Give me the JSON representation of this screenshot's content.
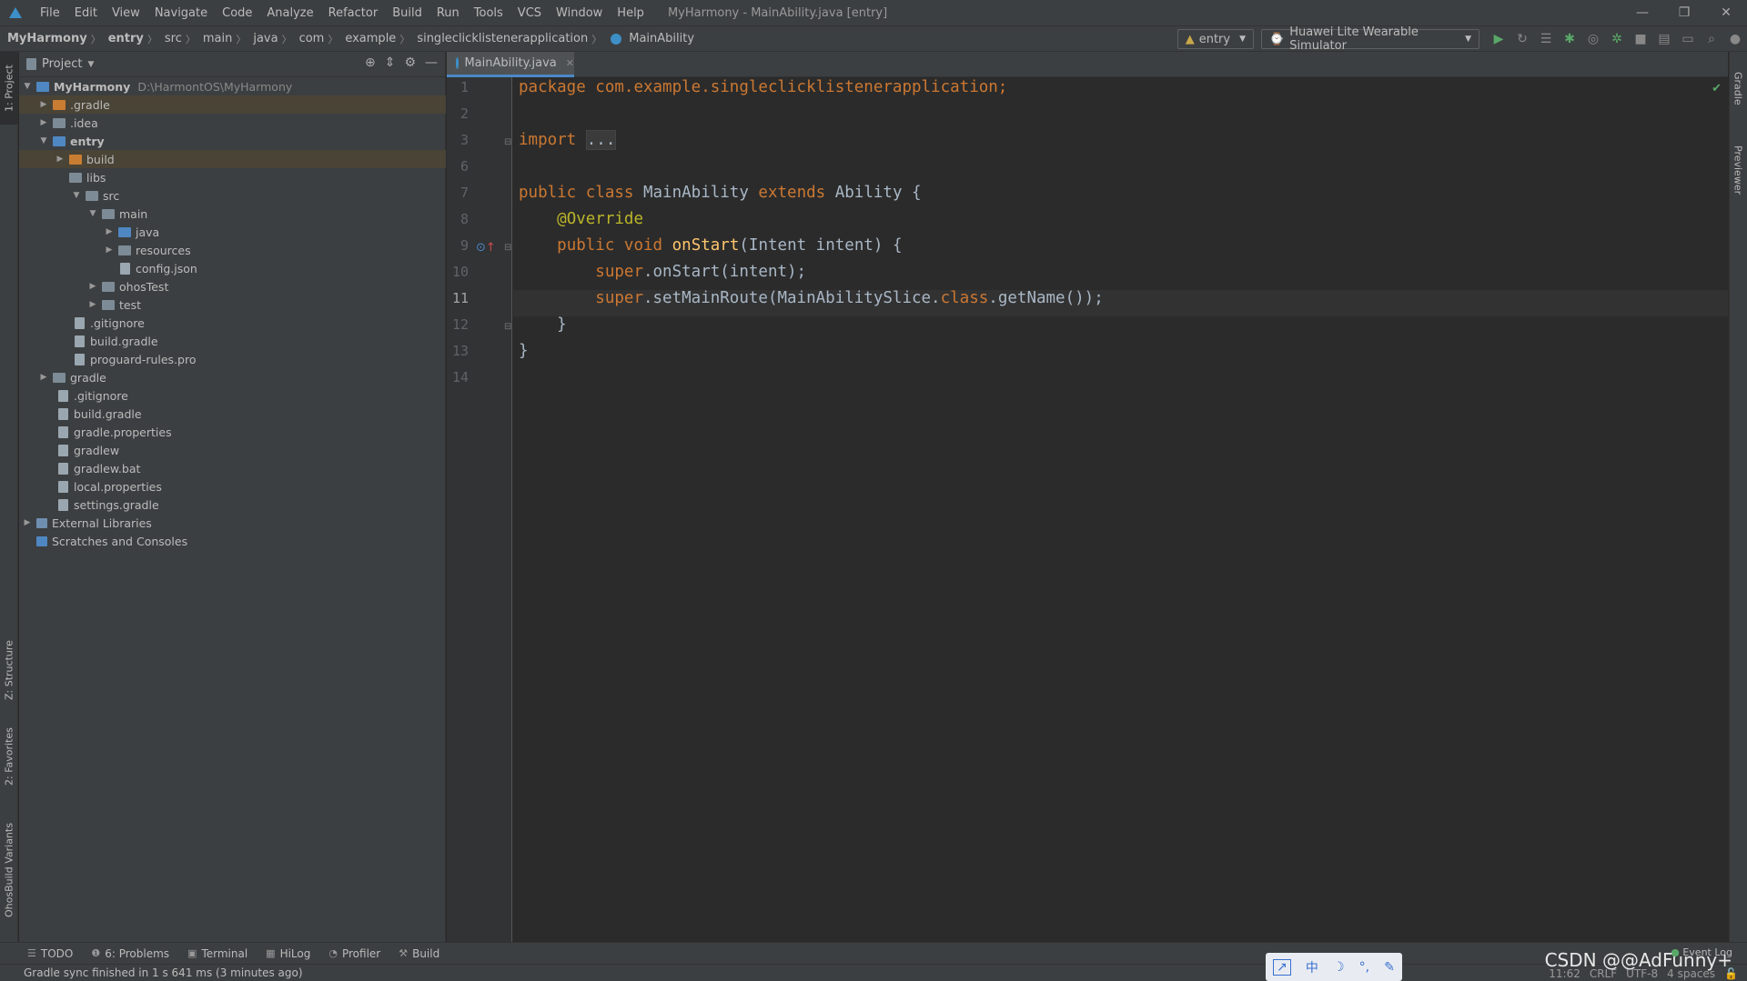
{
  "menu": {
    "items": [
      "File",
      "Edit",
      "View",
      "Navigate",
      "Code",
      "Analyze",
      "Refactor",
      "Build",
      "Run",
      "Tools",
      "VCS",
      "Window",
      "Help"
    ],
    "window_title": "MyHarmony - MainAbility.java [entry]"
  },
  "navbar": {
    "crumbs": [
      "MyHarmony",
      "entry",
      "src",
      "main",
      "java",
      "com",
      "example",
      "singleclicklistenerapplication",
      "MainAbility"
    ],
    "run_config": "entry",
    "device": "Huawei Lite Wearable Simulator"
  },
  "project": {
    "title": "Project",
    "tree": [
      {
        "label": "MyHarmony",
        "extra": "D:\\HarmontOS\\MyHarmony"
      },
      {
        "label": ".gradle"
      },
      {
        "label": ".idea"
      },
      {
        "label": "entry"
      },
      {
        "label": "build"
      },
      {
        "label": "libs"
      },
      {
        "label": "src"
      },
      {
        "label": "main"
      },
      {
        "label": "java"
      },
      {
        "label": "resources"
      },
      {
        "label": "config.json"
      },
      {
        "label": "ohosTest"
      },
      {
        "label": "test"
      },
      {
        "label": ".gitignore"
      },
      {
        "label": "build.gradle"
      },
      {
        "label": "proguard-rules.pro"
      },
      {
        "label": "gradle"
      },
      {
        "label": ".gitignore"
      },
      {
        "label": "build.gradle"
      },
      {
        "label": "gradle.properties"
      },
      {
        "label": "gradlew"
      },
      {
        "label": "gradlew.bat"
      },
      {
        "label": "local.properties"
      },
      {
        "label": "settings.gradle"
      },
      {
        "label": "External Libraries"
      },
      {
        "label": "Scratches and Consoles"
      }
    ]
  },
  "side_tabs": {
    "left": [
      "1: Project",
      "Z: Structure",
      "2: Favorites",
      "OhosBuild Variants"
    ],
    "right": [
      "Gradle",
      "Previewer"
    ]
  },
  "editor": {
    "tab_label": "MainAbility.java",
    "line_numbers": [
      "1",
      "2",
      "3",
      "6",
      "7",
      "8",
      "9",
      "10",
      "11",
      "12",
      "13",
      "14"
    ],
    "current_line": "11",
    "code": {
      "l1_kw": "package",
      "l1_rest": " com.example.singleclicklistenerapplication;",
      "l3_kw": "import",
      "l3_fold": "...",
      "l7_kw1": "public",
      "l7_kw2": "class",
      "l7_name": " MainAbility ",
      "l7_kw3": "extends",
      "l7_rest": " Ability {",
      "l8_ann": "@Override",
      "l9_kw1": "public",
      "l9_kw2": "void",
      "l9_fn": "onStart",
      "l9_rest": "(Intent intent) {",
      "l10_kw": "super",
      "l10_rest": ".onStart(intent);",
      "l11_kw": "super",
      "l11_rest1": ".setMainRoute(MainAbilitySlice.",
      "l11_kw2": "class",
      "l11_rest2": ".getName());",
      "l12": "}",
      "l13": "}"
    }
  },
  "bottom_tools": [
    "TODO",
    "6: Problems",
    "Terminal",
    "HiLog",
    "Profiler",
    "Build"
  ],
  "status": {
    "message": "Gradle sync finished in 1 s 641 ms (3 minutes ago)",
    "position": "11:62",
    "line_sep": "CRLF",
    "encoding": "UTF-8",
    "indent": "4 spaces",
    "event_log": "Event Log"
  },
  "ime": [
    "中",
    "☽",
    "°,",
    "✎"
  ],
  "watermark": "CSDN @@AdFunny+"
}
